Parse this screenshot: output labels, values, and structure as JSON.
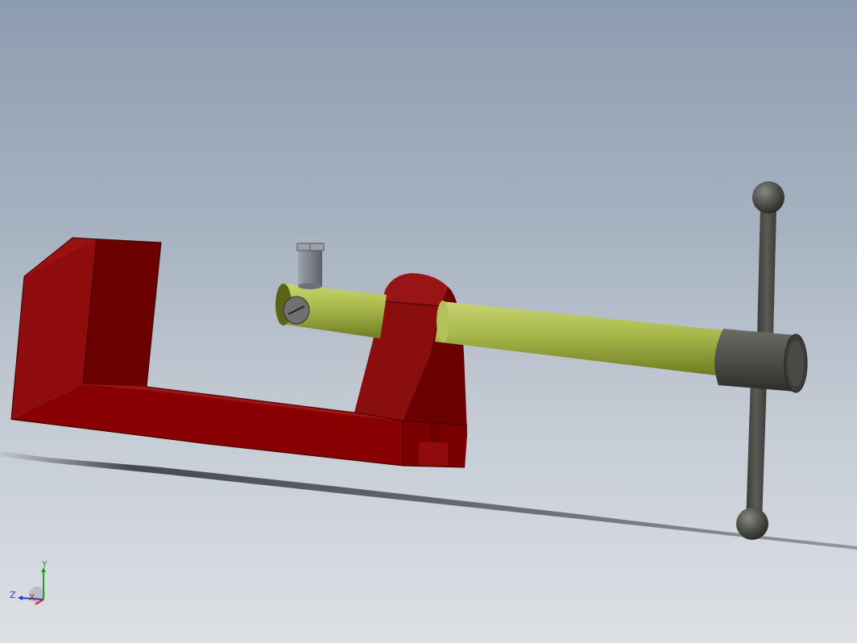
{
  "viewport": {
    "background_top": "#8c9caf",
    "background_bottom": "#dde1e6"
  },
  "model": {
    "frame_color": "#7a0000",
    "screw_color": "#a8b84a",
    "handle_color": "#4a4a46",
    "pin_color": "#8a8d96"
  },
  "triad": {
    "x_label": "X",
    "y_label": "Y",
    "z_label": "Z",
    "x_color": "#d02020",
    "y_color": "#20a020",
    "z_color": "#2040d0"
  }
}
